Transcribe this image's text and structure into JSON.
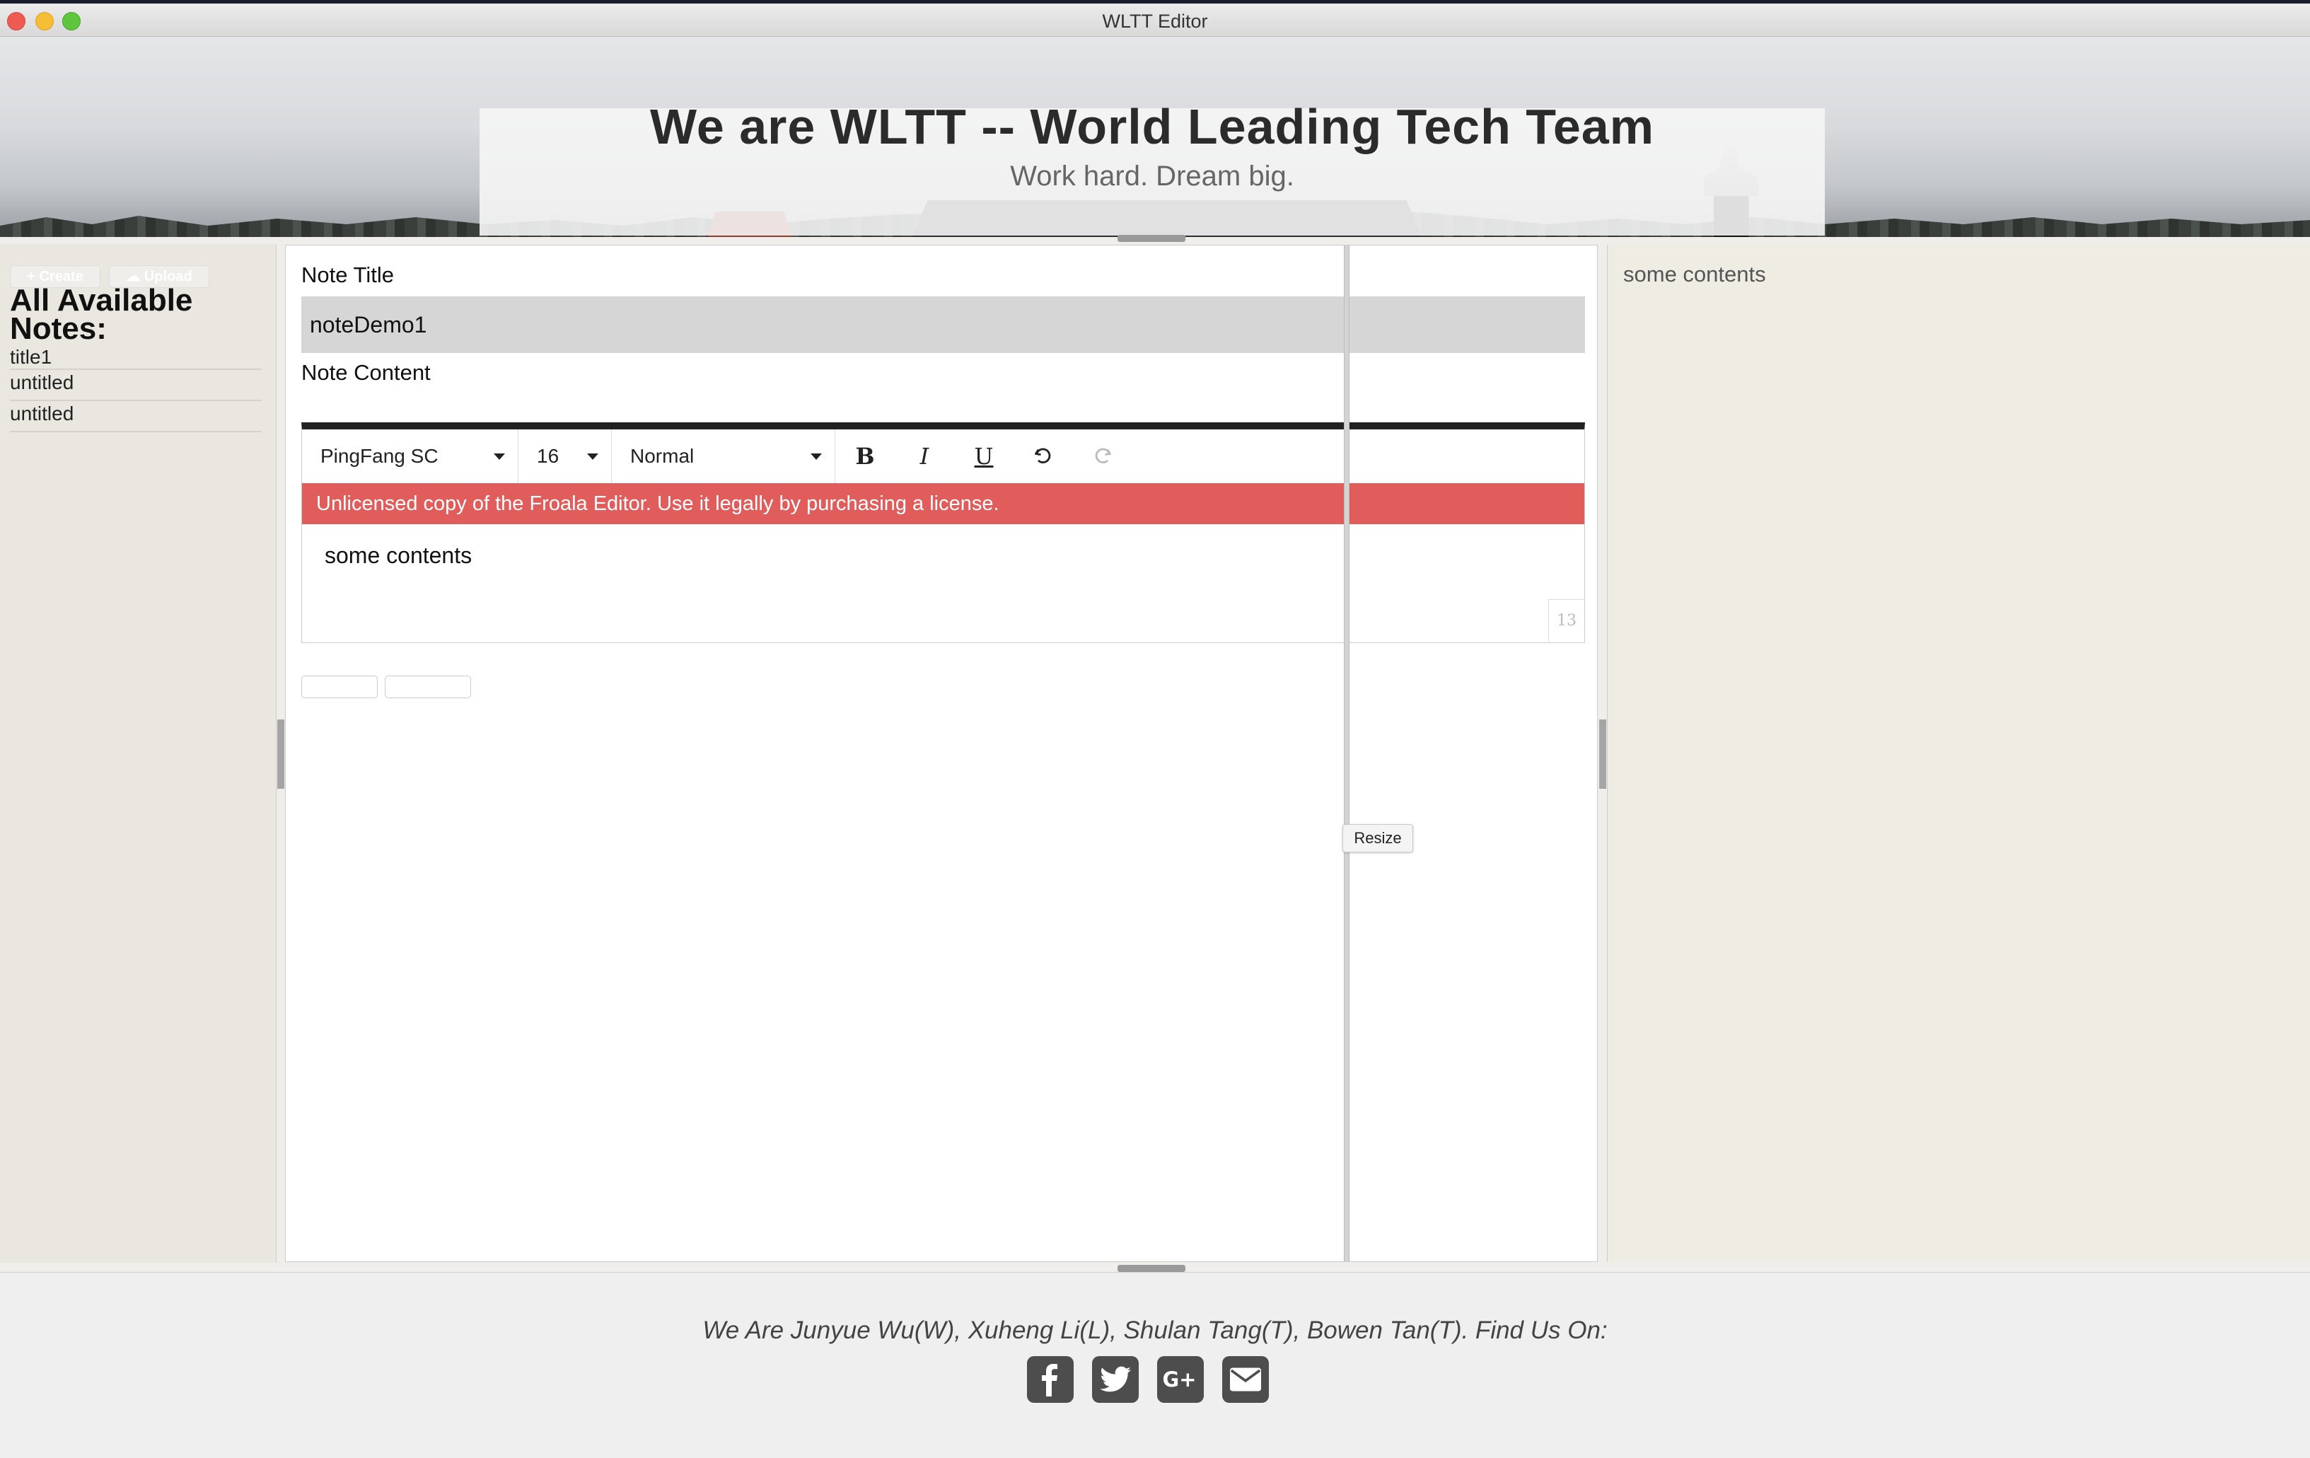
{
  "window": {
    "title": "WLTT Editor"
  },
  "banner": {
    "title": "We are WLTT -- World Leading Tech Team",
    "subtitle": "Work hard. Dream big."
  },
  "sidebar": {
    "create_label": "+ Create",
    "upload_label": "☁ Upload",
    "heading": "All Available Notes:",
    "notes": [
      {
        "title": "title1"
      },
      {
        "title": "untitled"
      },
      {
        "title": "untitled"
      }
    ]
  },
  "editor": {
    "title_label": "Note Title",
    "title_value": "noteDemo1",
    "content_label": "Note Content",
    "toolbar": {
      "font_family": "PingFang SC",
      "font_size": "16",
      "paragraph_format": "Normal",
      "bold_glyph": "B",
      "italic_glyph": "I",
      "underline_glyph": "U",
      "undo_icon": "undo-icon",
      "redo_icon": "redo-icon"
    },
    "license_warning": "Unlicensed copy of the Froala Editor. Use it legally by purchasing a license.",
    "content": "some contents",
    "char_count": "13",
    "resize_tooltip": "Resize"
  },
  "preview": {
    "content": "some contents"
  },
  "footer": {
    "credits": "We Are Junyue Wu(W), Xuheng Li(L), Shulan Tang(T), Bowen Tan(T). Find Us On:",
    "social_icons": [
      "facebook-icon",
      "twitter-icon",
      "google-plus-icon",
      "email-icon"
    ]
  },
  "colors": {
    "license_bar": "#e05d5b",
    "sidebar_bg": "#e9e7df",
    "preview_bg": "#efece4",
    "social_icon_bg": "#4d4d4d"
  }
}
